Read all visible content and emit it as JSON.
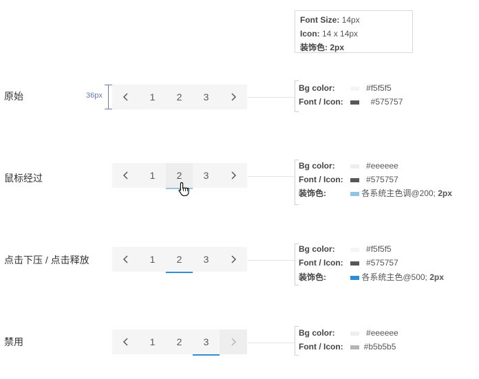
{
  "spec": {
    "font_size_key": "Font Size:",
    "font_size_val": " 14px",
    "icon_key": "Icon:",
    "icon_val": " 14 x 14px",
    "deco_key": "装饰色:",
    "deco_val": " 2px"
  },
  "measure": {
    "label": "36px"
  },
  "pages": [
    "1",
    "2",
    "3"
  ],
  "icons": {
    "prev": "chevron-left-icon",
    "next": "chevron-right-icon",
    "cursor": "hand-pointer-icon"
  },
  "states": [
    {
      "label": "原始",
      "bg_key": "Bg color:",
      "bg_val": "#f5f5f5",
      "bg_swatch": "#f5f5f5",
      "font_key": "Font / Icon:",
      "font_val": "#575757",
      "font_swatch": "#575757"
    },
    {
      "label": "鼠标经过",
      "bg_key": "Bg color:",
      "bg_val": "#eeeeee",
      "bg_swatch": "#eeeeee",
      "font_key": "Font / Icon:",
      "font_val": "#575757",
      "font_swatch": "#575757",
      "deco_key": "装饰色:",
      "deco_val": "各系统主色调@200;",
      "deco_bold": "2px",
      "deco_swatch": "#8fc3e8"
    },
    {
      "label": "点击下压 / 点击释放",
      "bg_key": "Bg color:",
      "bg_val": "#f5f5f5",
      "bg_swatch": "#f5f5f5",
      "font_key": "Font / Icon:",
      "font_val": "#575757",
      "font_swatch": "#575757",
      "deco_key": "装饰色:",
      "deco_val": "各系统主色@500;",
      "deco_bold": "2px",
      "deco_swatch": "#2d8ed6"
    },
    {
      "label": "禁用",
      "bg_key": "Bg color:",
      "bg_val": "#eeeeee",
      "bg_swatch": "#eeeeee",
      "font_key": "Font / Icon:",
      "font_val": "#b5b5b5",
      "font_swatch": "#b5b5b5"
    }
  ],
  "colors": {
    "pager_bg": "#f5f5f5",
    "hover_bg": "#eeeeee",
    "hover_underline": "#8fc3e8",
    "active_underline": "#2d8ed6",
    "text": "#575757",
    "disabled_icon": "#b5b5b5"
  }
}
